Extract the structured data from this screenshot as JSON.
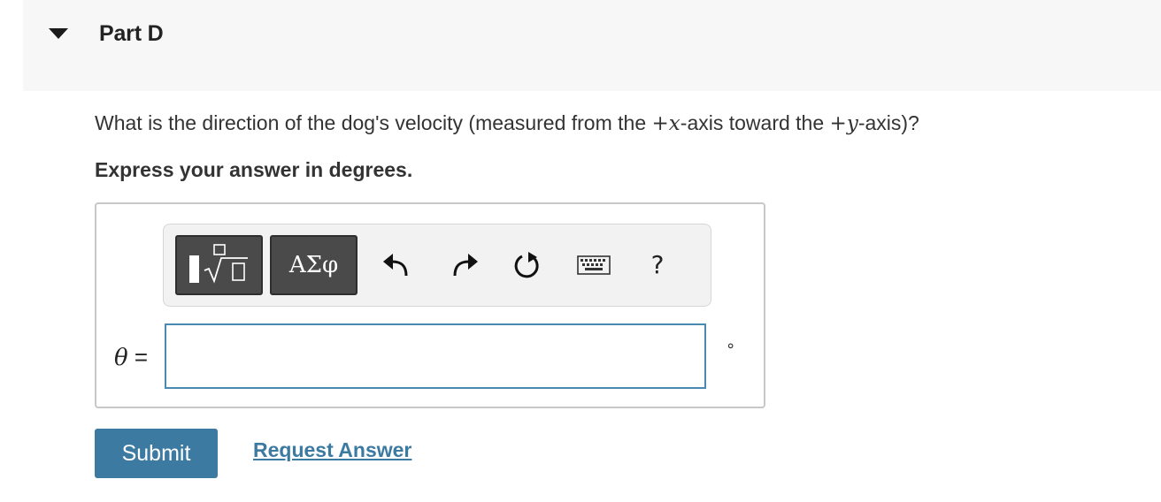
{
  "part": {
    "title": "Part D",
    "expanded": true
  },
  "question": {
    "text_before_x": "What is the direction of the dog's velocity (measured from the ",
    "plus_x": "+",
    "x_var": "x",
    "text_between": "-axis toward the ",
    "plus_y": "+",
    "y_var": "y",
    "text_after_y": "-axis)?"
  },
  "instruction": "Express your answer in degrees.",
  "toolbar": {
    "greek_label": "ΑΣφ",
    "help_label": "?",
    "icons": [
      "templates-icon",
      "greek-symbols-button",
      "undo-icon",
      "redo-icon",
      "reset-icon",
      "keyboard-icon",
      "help-icon"
    ]
  },
  "answer": {
    "variable_symbol": "θ",
    "equals": " = ",
    "value": "",
    "unit": "∘"
  },
  "actions": {
    "submit_label": "Submit",
    "request_answer_label": "Request Answer"
  },
  "colors": {
    "accent": "#3d7aa2",
    "header_bg": "#f7f7f7",
    "toolbar_dark_button": "#4a4a4a",
    "input_border": "#4a8ab0"
  }
}
